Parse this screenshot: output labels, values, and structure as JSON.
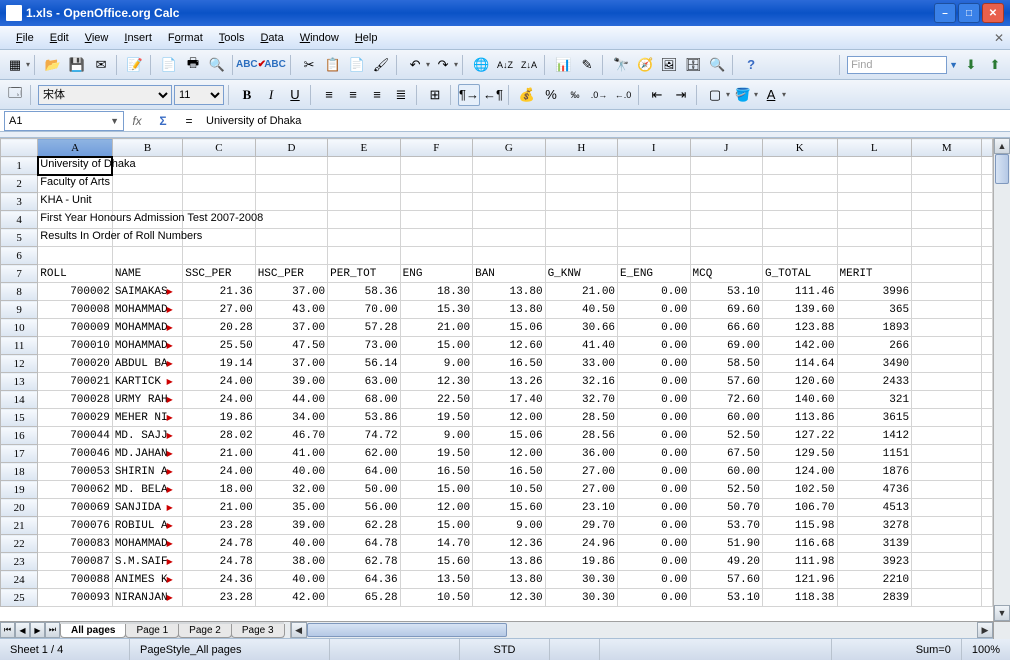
{
  "title": "1.xls - OpenOffice.org Calc",
  "menus": [
    "File",
    "Edit",
    "View",
    "Insert",
    "Format",
    "Tools",
    "Data",
    "Window",
    "Help"
  ],
  "font_name": "宋体",
  "font_size": "11",
  "name_box": "A1",
  "formula_value": "University of Dhaka",
  "find_placeholder": "Find",
  "columns": [
    "A",
    "B",
    "C",
    "D",
    "E",
    "F",
    "G",
    "H",
    "I",
    "J",
    "K",
    "L",
    "M"
  ],
  "header_text_rows": [
    "University of Dhaka",
    "Faculty of Arts",
    "KHA - Unit",
    "First Year Honours Admission Test 2007-2008",
    "Results In Order of Roll Numbers",
    ""
  ],
  "col_headers": [
    "ROLL",
    "NAME",
    "SSC_PER",
    "HSC_PER",
    "PER_TOT",
    "ENG",
    "BAN",
    "G_KNW",
    "E_ENG",
    "MCQ",
    "G_TOTAL",
    "MERIT"
  ],
  "rows": [
    {
      "n": 8,
      "roll": "700002",
      "name": "SAIMAKAS",
      "ssc": "21.36",
      "hsc": "37.00",
      "tot": "58.36",
      "eng": "18.30",
      "ban": "13.80",
      "gkn": "21.00",
      "eeng": "0.00",
      "mcq": "53.10",
      "gt": "111.46",
      "merit": "3996"
    },
    {
      "n": 9,
      "roll": "700008",
      "name": "MOHAMMAD",
      "ssc": "27.00",
      "hsc": "43.00",
      "tot": "70.00",
      "eng": "15.30",
      "ban": "13.80",
      "gkn": "40.50",
      "eeng": "0.00",
      "mcq": "69.60",
      "gt": "139.60",
      "merit": "365"
    },
    {
      "n": 10,
      "roll": "700009",
      "name": "MOHAMMAD",
      "ssc": "20.28",
      "hsc": "37.00",
      "tot": "57.28",
      "eng": "21.00",
      "ban": "15.06",
      "gkn": "30.66",
      "eeng": "0.00",
      "mcq": "66.60",
      "gt": "123.88",
      "merit": "1893"
    },
    {
      "n": 11,
      "roll": "700010",
      "name": "MOHAMMAD",
      "ssc": "25.50",
      "hsc": "47.50",
      "tot": "73.00",
      "eng": "15.00",
      "ban": "12.60",
      "gkn": "41.40",
      "eeng": "0.00",
      "mcq": "69.00",
      "gt": "142.00",
      "merit": "266"
    },
    {
      "n": 12,
      "roll": "700020",
      "name": "ABDUL BA",
      "ssc": "19.14",
      "hsc": "37.00",
      "tot": "56.14",
      "eng": "9.00",
      "ban": "16.50",
      "gkn": "33.00",
      "eeng": "0.00",
      "mcq": "58.50",
      "gt": "114.64",
      "merit": "3490"
    },
    {
      "n": 13,
      "roll": "700021",
      "name": "KARTICK ",
      "ssc": "24.00",
      "hsc": "39.00",
      "tot": "63.00",
      "eng": "12.30",
      "ban": "13.26",
      "gkn": "32.16",
      "eeng": "0.00",
      "mcq": "57.60",
      "gt": "120.60",
      "merit": "2433"
    },
    {
      "n": 14,
      "roll": "700028",
      "name": "URMY RAH",
      "ssc": "24.00",
      "hsc": "44.00",
      "tot": "68.00",
      "eng": "22.50",
      "ban": "17.40",
      "gkn": "32.70",
      "eeng": "0.00",
      "mcq": "72.60",
      "gt": "140.60",
      "merit": "321"
    },
    {
      "n": 15,
      "roll": "700029",
      "name": "MEHER NI",
      "ssc": "19.86",
      "hsc": "34.00",
      "tot": "53.86",
      "eng": "19.50",
      "ban": "12.00",
      "gkn": "28.50",
      "eeng": "0.00",
      "mcq": "60.00",
      "gt": "113.86",
      "merit": "3615"
    },
    {
      "n": 16,
      "roll": "700044",
      "name": "MD. SAJJ",
      "ssc": "28.02",
      "hsc": "46.70",
      "tot": "74.72",
      "eng": "9.00",
      "ban": "15.06",
      "gkn": "28.56",
      "eeng": "0.00",
      "mcq": "52.50",
      "gt": "127.22",
      "merit": "1412"
    },
    {
      "n": 17,
      "roll": "700046",
      "name": "MD.JAHAN",
      "ssc": "21.00",
      "hsc": "41.00",
      "tot": "62.00",
      "eng": "19.50",
      "ban": "12.00",
      "gkn": "36.00",
      "eeng": "0.00",
      "mcq": "67.50",
      "gt": "129.50",
      "merit": "1151"
    },
    {
      "n": 18,
      "roll": "700053",
      "name": "SHIRIN A",
      "ssc": "24.00",
      "hsc": "40.00",
      "tot": "64.00",
      "eng": "16.50",
      "ban": "16.50",
      "gkn": "27.00",
      "eeng": "0.00",
      "mcq": "60.00",
      "gt": "124.00",
      "merit": "1876"
    },
    {
      "n": 19,
      "roll": "700062",
      "name": "MD. BELA",
      "ssc": "18.00",
      "hsc": "32.00",
      "tot": "50.00",
      "eng": "15.00",
      "ban": "10.50",
      "gkn": "27.00",
      "eeng": "0.00",
      "mcq": "52.50",
      "gt": "102.50",
      "merit": "4736"
    },
    {
      "n": 20,
      "roll": "700069",
      "name": "SANJIDA ",
      "ssc": "21.00",
      "hsc": "35.00",
      "tot": "56.00",
      "eng": "12.00",
      "ban": "15.60",
      "gkn": "23.10",
      "eeng": "0.00",
      "mcq": "50.70",
      "gt": "106.70",
      "merit": "4513"
    },
    {
      "n": 21,
      "roll": "700076",
      "name": "ROBIUL A",
      "ssc": "23.28",
      "hsc": "39.00",
      "tot": "62.28",
      "eng": "15.00",
      "ban": "9.00",
      "gkn": "29.70",
      "eeng": "0.00",
      "mcq": "53.70",
      "gt": "115.98",
      "merit": "3278"
    },
    {
      "n": 22,
      "roll": "700083",
      "name": "MOHAMMAD",
      "ssc": "24.78",
      "hsc": "40.00",
      "tot": "64.78",
      "eng": "14.70",
      "ban": "12.36",
      "gkn": "24.96",
      "eeng": "0.00",
      "mcq": "51.90",
      "gt": "116.68",
      "merit": "3139"
    },
    {
      "n": 23,
      "roll": "700087",
      "name": "S.M.SAIF",
      "ssc": "24.78",
      "hsc": "38.00",
      "tot": "62.78",
      "eng": "15.60",
      "ban": "13.86",
      "gkn": "19.86",
      "eeng": "0.00",
      "mcq": "49.20",
      "gt": "111.98",
      "merit": "3923"
    },
    {
      "n": 24,
      "roll": "700088",
      "name": "ANIMES K",
      "ssc": "24.36",
      "hsc": "40.00",
      "tot": "64.36",
      "eng": "13.50",
      "ban": "13.80",
      "gkn": "30.30",
      "eeng": "0.00",
      "mcq": "57.60",
      "gt": "121.96",
      "merit": "2210"
    },
    {
      "n": 25,
      "roll": "700093",
      "name": "NIRANJAN",
      "ssc": "23.28",
      "hsc": "42.00",
      "tot": "65.28",
      "eng": "10.50",
      "ban": "12.30",
      "gkn": "30.30",
      "eeng": "0.00",
      "mcq": "53.10",
      "gt": "118.38",
      "merit": "2839"
    }
  ],
  "tabs": [
    "All pages",
    "Page 1",
    "Page 2",
    "Page 3"
  ],
  "active_tab": 0,
  "status": {
    "sheet": "Sheet 1 / 4",
    "pagestyle": "PageStyle_All pages",
    "std": "STD",
    "sum": "Sum=0",
    "zoom": "100%"
  }
}
